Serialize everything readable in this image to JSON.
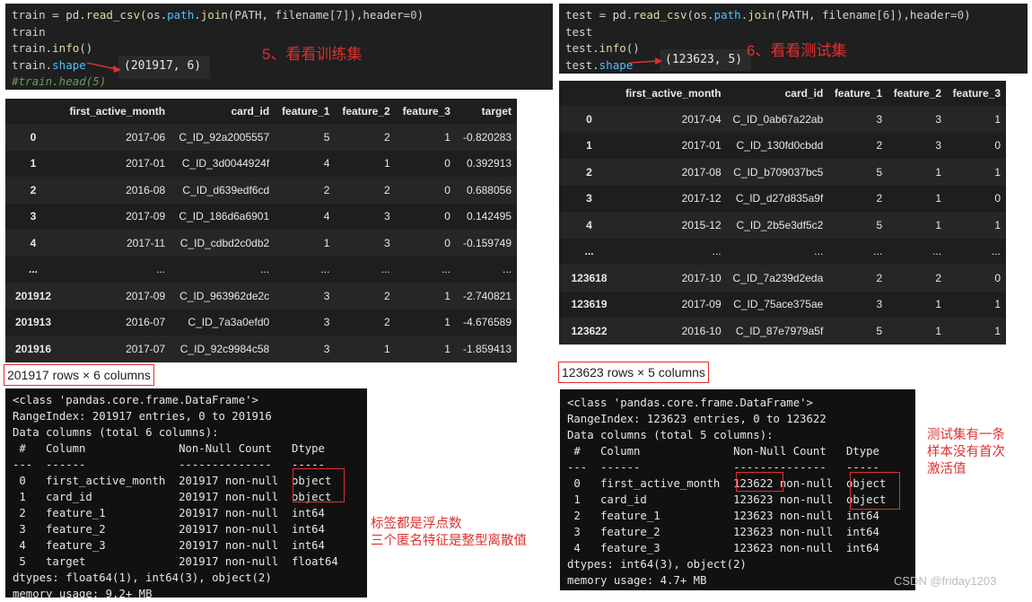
{
  "train": {
    "code": {
      "line1_var": "train",
      "line1_eq": " = pd.",
      "line1_fn": "read_csv",
      "line1_mid1": "(os.",
      "line1_attr1": "path",
      "line1_dot": ".",
      "line1_fn2": "join",
      "line1_mid2": "(PATH, filename[",
      "line1_num": "7",
      "line1_mid3": "]),header=",
      "line1_num2": "0",
      "line1_end": ")",
      "line2": "train",
      "line3_a": "train.",
      "line3_fn": "info",
      "line3_b": "()",
      "line4_a": "train.",
      "line4_attr": "shape",
      "line5": "#train.head(5)"
    },
    "shape_output": "(201917, 6)",
    "annotation": "5、看看训练集",
    "columns": [
      "",
      "first_active_month",
      "card_id",
      "feature_1",
      "feature_2",
      "feature_3",
      "target"
    ],
    "rows": [
      [
        "0",
        "2017-06",
        "C_ID_92a2005557",
        "5",
        "2",
        "1",
        "-0.820283"
      ],
      [
        "1",
        "2017-01",
        "C_ID_3d0044924f",
        "4",
        "1",
        "0",
        "0.392913"
      ],
      [
        "2",
        "2016-08",
        "C_ID_d639edf6cd",
        "2",
        "2",
        "0",
        "0.688056"
      ],
      [
        "3",
        "2017-09",
        "C_ID_186d6a6901",
        "4",
        "3",
        "0",
        "0.142495"
      ],
      [
        "4",
        "2017-11",
        "C_ID_cdbd2c0db2",
        "1",
        "3",
        "0",
        "-0.159749"
      ],
      [
        "...",
        "...",
        "...",
        "...",
        "...",
        "...",
        "..."
      ],
      [
        "201912",
        "2017-09",
        "C_ID_963962de2c",
        "3",
        "2",
        "1",
        "-2.740821"
      ],
      [
        "201913",
        "2016-07",
        "C_ID_7a3a0efd0",
        "3",
        "2",
        "1",
        "-4.676589"
      ],
      [
        "201916",
        "2017-07",
        "C_ID_92c9984c58",
        "3",
        "1",
        "1",
        "-1.859413"
      ]
    ],
    "row_count": "201917 rows × 6 columns",
    "info_lines": [
      "<class 'pandas.core.frame.DataFrame'>",
      "RangeIndex: 201917 entries, 0 to 201916",
      "Data columns (total 6 columns):",
      " #   Column              Non-Null Count   Dtype  ",
      "---  ------              --------------   -----  ",
      " 0   first_active_month  201917 non-null  object ",
      " 1   card_id             201917 non-null  object ",
      " 2   feature_1           201917 non-null  int64  ",
      " 3   feature_2           201917 non-null  int64  ",
      " 4   feature_3           201917 non-null  int64  ",
      " 5   target              201917 non-null  float64",
      "dtypes: float64(1), int64(3), object(2)",
      "memory usage: 9.2+ MB"
    ],
    "note_line1": "标签都是浮点数",
    "note_line2": "三个匿名特征是整型离散值"
  },
  "test": {
    "code": {
      "line1_var": "test",
      "line1_eq": " = pd.",
      "line1_fn": "read_csv",
      "line1_mid1": "(os.",
      "line1_attr1": "path",
      "line1_dot": ".",
      "line1_fn2": "join",
      "line1_mid2": "(PATH, filename[",
      "line1_num": "6",
      "line1_mid3": "]),header=",
      "line1_num2": "0",
      "line1_end": ")",
      "line2": "test",
      "line3_a": "test.",
      "line3_fn": "info",
      "line3_b": "()",
      "line4_a": "test.",
      "line4_attr": "shape"
    },
    "shape_output": "(123623, 5)",
    "annotation": "6、看看测试集",
    "columns": [
      "",
      "first_active_month",
      "card_id",
      "feature_1",
      "feature_2",
      "feature_3"
    ],
    "rows": [
      [
        "0",
        "2017-04",
        "C_ID_0ab67a22ab",
        "3",
        "3",
        "1"
      ],
      [
        "1",
        "2017-01",
        "C_ID_130fd0cbdd",
        "2",
        "3",
        "0"
      ],
      [
        "2",
        "2017-08",
        "C_ID_b709037bc5",
        "5",
        "1",
        "1"
      ],
      [
        "3",
        "2017-12",
        "C_ID_d27d835a9f",
        "2",
        "1",
        "0"
      ],
      [
        "4",
        "2015-12",
        "C_ID_2b5e3df5c2",
        "5",
        "1",
        "1"
      ],
      [
        "...",
        "...",
        "...",
        "...",
        "...",
        "..."
      ],
      [
        "123618",
        "2017-10",
        "C_ID_7a239d2eda",
        "2",
        "2",
        "0"
      ],
      [
        "123619",
        "2017-09",
        "C_ID_75ace375ae",
        "3",
        "1",
        "1"
      ],
      [
        "123622",
        "2016-10",
        "C_ID_87e7979a5f",
        "5",
        "1",
        "1"
      ]
    ],
    "row_count": "123623 rows × 5 columns",
    "info_lines": [
      "<class 'pandas.core.frame.DataFrame'>",
      "RangeIndex: 123623 entries, 0 to 123622",
      "Data columns (total 5 columns):",
      " #   Column              Non-Null Count   Dtype ",
      "---  ------              --------------   ----- ",
      " 0   first_active_month  123622 non-null  object",
      " 1   card_id             123623 non-null  object",
      " 2   feature_1           123623 non-null  int64 ",
      " 3   feature_2           123623 non-null  int64 ",
      " 4   feature_3           123623 non-null  int64 ",
      "dtypes: int64(3), object(2)",
      "memory usage: 4.7+ MB"
    ],
    "note_line1": "测试集有一条",
    "note_line2": "样本没有首次",
    "note_line3": "激活值"
  },
  "watermark": "CSDN @friday1203",
  "colors": {
    "annotation_red": "#e03030",
    "cell_bg": "#1e1e1e"
  }
}
